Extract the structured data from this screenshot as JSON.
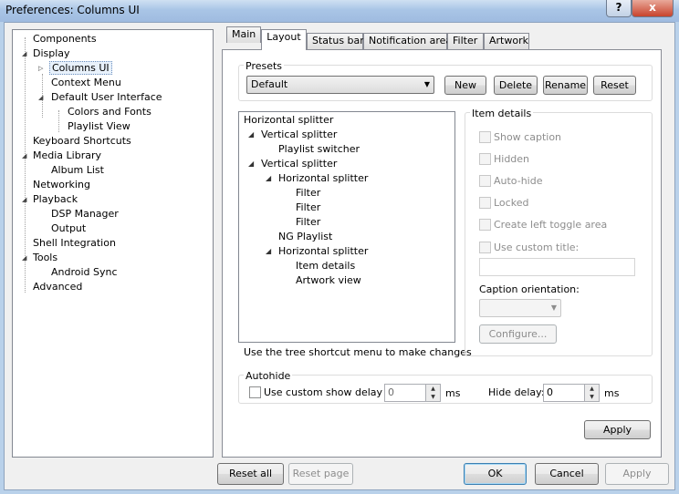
{
  "window": {
    "title": "Preferences: Columns UI",
    "help_label": "?",
    "close_label": "x"
  },
  "tree": [
    {
      "label": "Components"
    },
    {
      "label": "Display"
    },
    {
      "label": "Columns UI"
    },
    {
      "label": "Context Menu"
    },
    {
      "label": "Default User Interface"
    },
    {
      "label": "Colors and Fonts"
    },
    {
      "label": "Playlist View"
    },
    {
      "label": "Keyboard Shortcuts"
    },
    {
      "label": "Media Library"
    },
    {
      "label": "Album List"
    },
    {
      "label": "Networking"
    },
    {
      "label": "Playback"
    },
    {
      "label": "DSP Manager"
    },
    {
      "label": "Output"
    },
    {
      "label": "Shell Integration"
    },
    {
      "label": "Tools"
    },
    {
      "label": "Android Sync"
    },
    {
      "label": "Advanced"
    }
  ],
  "tabs": [
    "Main",
    "Layout",
    "Status bar",
    "Notification area",
    "Filter",
    "Artwork"
  ],
  "presets": {
    "title": "Presets",
    "selected": "Default",
    "new_label": "New",
    "delete_label": "Delete",
    "rename_label": "Rename",
    "reset_label": "Reset"
  },
  "layout_tree": [
    {
      "label": "Horizontal splitter"
    },
    {
      "label": "Vertical splitter"
    },
    {
      "label": "Playlist switcher"
    },
    {
      "label": "Vertical splitter"
    },
    {
      "label": "Horizontal splitter"
    },
    {
      "label": "Filter"
    },
    {
      "label": "Filter"
    },
    {
      "label": "Filter"
    },
    {
      "label": "NG Playlist"
    },
    {
      "label": "Horizontal splitter"
    },
    {
      "label": "Item details"
    },
    {
      "label": "Artwork view"
    }
  ],
  "tree_hint": "Use the tree shortcut menu to make changes",
  "item_details": {
    "title": "Item details",
    "show_caption": "Show caption",
    "hidden": "Hidden",
    "auto_hide": "Auto-hide",
    "locked": "Locked",
    "create_left_toggle": "Create left toggle area",
    "use_custom_title": "Use custom title:",
    "caption_orientation": "Caption orientation:",
    "configure_label": "Configure..."
  },
  "autohide": {
    "title": "Autohide",
    "use_custom_show_delay": "Use custom show delay of",
    "show_delay_value": "0",
    "ms1": "ms",
    "hide_delay_label": "Hide delay:",
    "hide_delay_value": "0",
    "ms2": "ms"
  },
  "apply_tab_label": "Apply",
  "footer": {
    "reset_all": "Reset all",
    "reset_page": "Reset page",
    "ok": "OK",
    "cancel": "Cancel",
    "apply": "Apply"
  }
}
